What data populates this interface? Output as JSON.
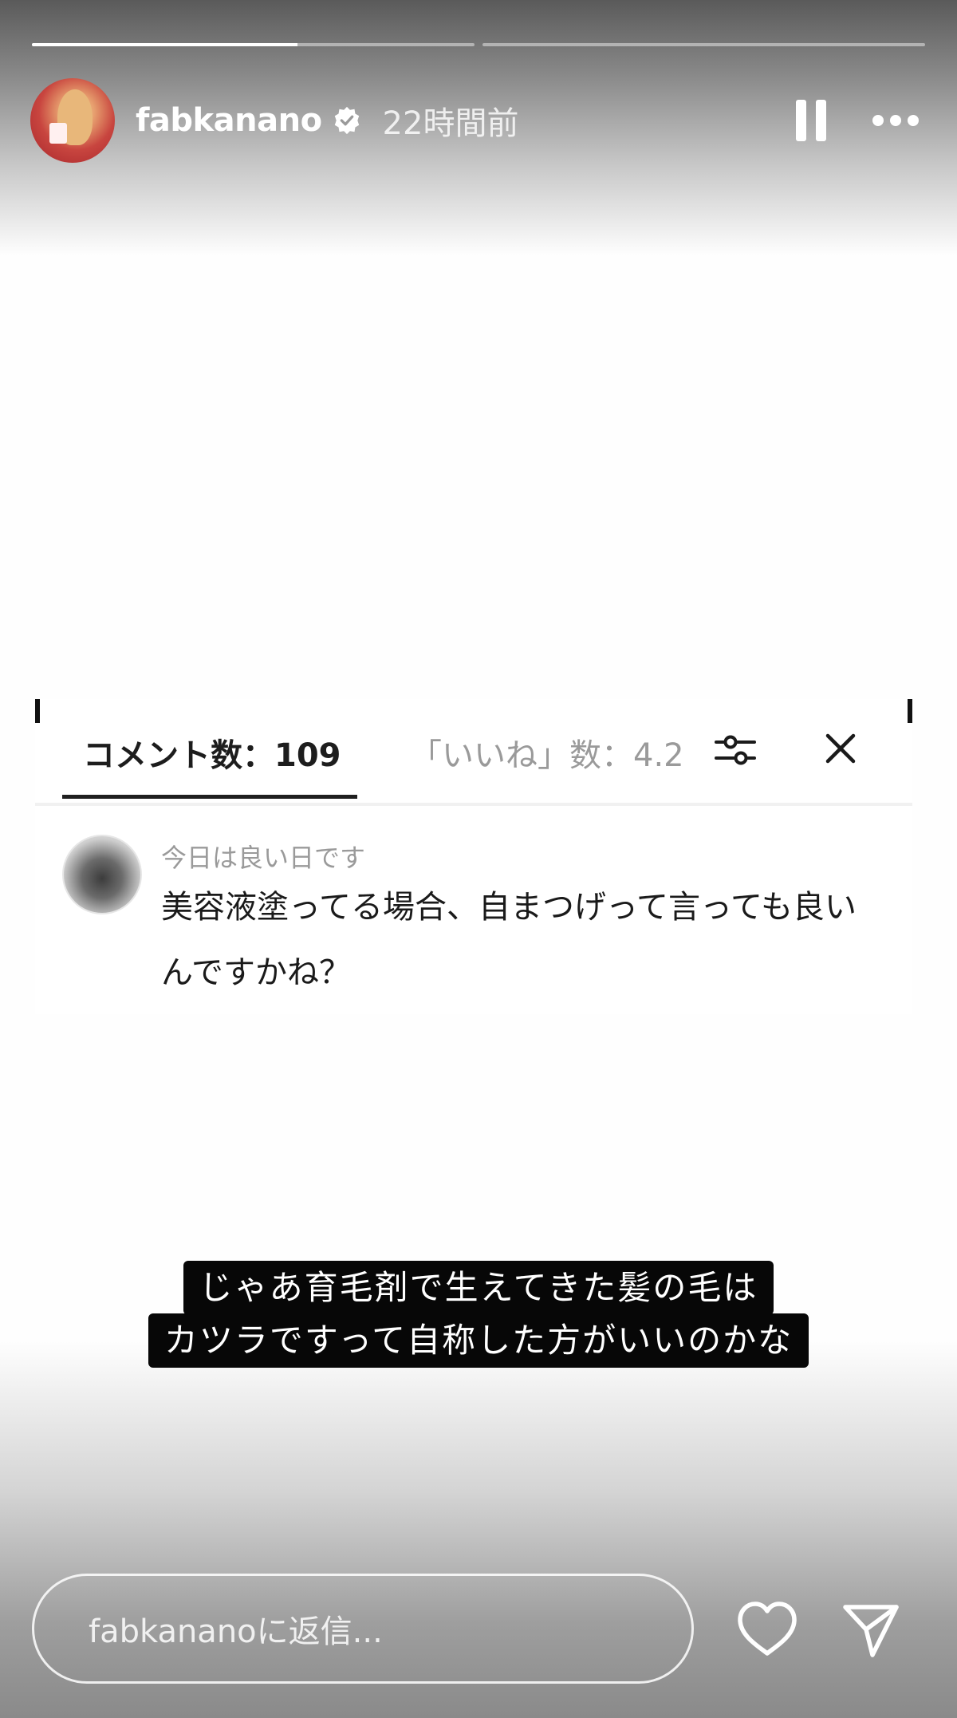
{
  "progress": [
    {
      "fill": 0.6
    },
    {
      "fill": 0.0
    }
  ],
  "header": {
    "username": "fabkanano",
    "time_ago": "22時間前"
  },
  "card": {
    "tab_comments": "コメント数：109",
    "tab_likes": "「いいね」数：4.2",
    "comment": {
      "user": "今日は良い日です",
      "text": "美容液塗ってる場合、自まつげって言っても良いんですかね？"
    }
  },
  "caption": {
    "line1": "じゃあ育毛剤で生えてきた髪の毛は",
    "line2": "カツラですって自称した方がいいのかな"
  },
  "reply": {
    "placeholder": "fabkananoに返信..."
  }
}
